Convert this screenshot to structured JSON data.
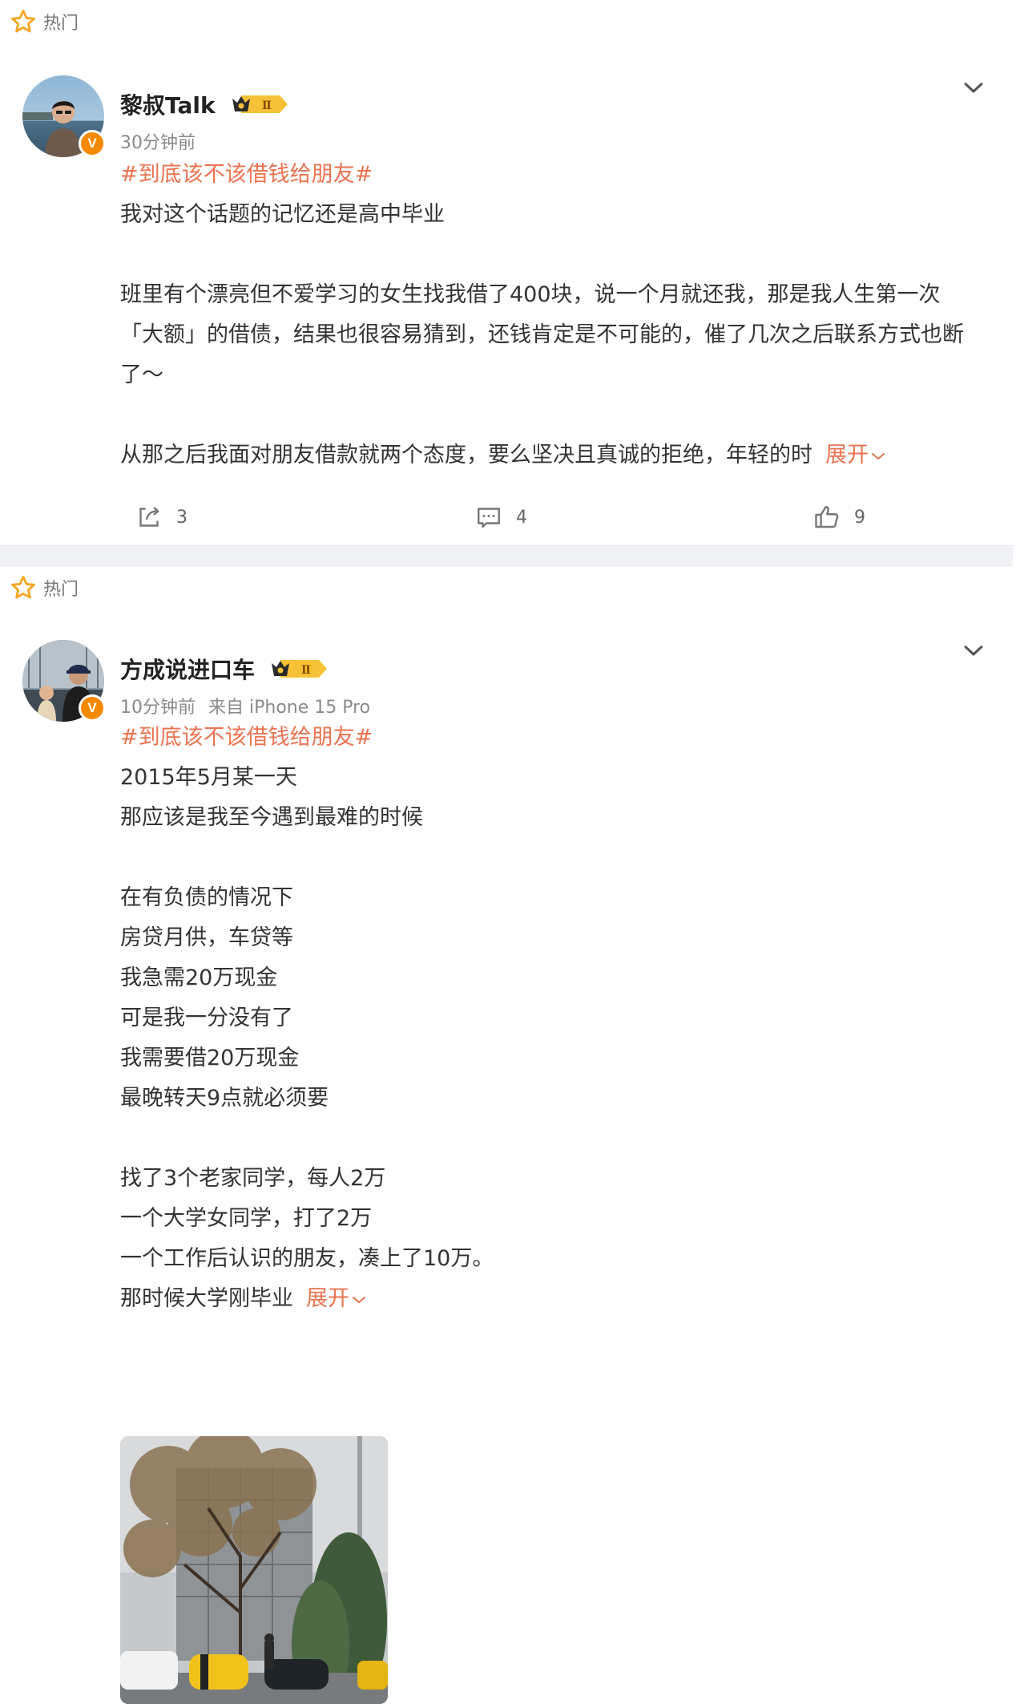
{
  "posts": [
    {
      "hot_label": "热门",
      "author": "黎叔Talk",
      "badge_text": "Ⅱ",
      "time": "30分钟前",
      "source": "",
      "topic": "#到底该不该借钱给朋友#",
      "paragraphs": [
        "我对这个话题的记忆还是高中毕业",
        "",
        "班里有个漂亮但不爱学习的女生找我借了400块，说一个月就还我，那是我人生第一次「大额」的借债，结果也很容易猜到，还钱肯定是不可能的，催了几次之后联系方式也断了～",
        "",
        "从那之后我面对朋友借款就两个态度，要么坚决且真诚的拒绝，年轻的时"
      ],
      "expand_label": "展开",
      "actions": {
        "repost": "3",
        "comment": "4",
        "like": "9"
      }
    },
    {
      "hot_label": "热门",
      "author": "方成说进口车",
      "badge_text": "Ⅱ",
      "time": "10分钟前",
      "source": "来自 iPhone 15 Pro",
      "topic": "#到底该不该借钱给朋友#",
      "paragraphs": [
        "2015年5月某一天",
        "那应该是我至今遇到最难的时候",
        "",
        "在有负债的情况下",
        "房贷月供，车贷等",
        "我急需20万现金",
        "可是我一分没有了",
        "我需要借20万现金",
        "最晚转天9点就必须要",
        "",
        "找了3个老家同学，每人2万",
        "一个大学女同学，打了2万",
        "一个工作后认识的朋友，凑上了10万。",
        "那时候大学刚毕业"
      ],
      "expand_label": "展开"
    }
  ],
  "icons": {
    "hot": "star-icon",
    "menu": "chevron-down-icon",
    "verified": "verified-v-icon",
    "repost": "repost-icon",
    "comment": "comment-icon",
    "like": "thumbs-up-icon"
  },
  "verified_mark": "V",
  "colors": {
    "accent": "#eb7350",
    "star": "#f5a623",
    "verified": "#f58a00",
    "badge_gold": "#f7c137",
    "separator": "#f1f2f5"
  }
}
